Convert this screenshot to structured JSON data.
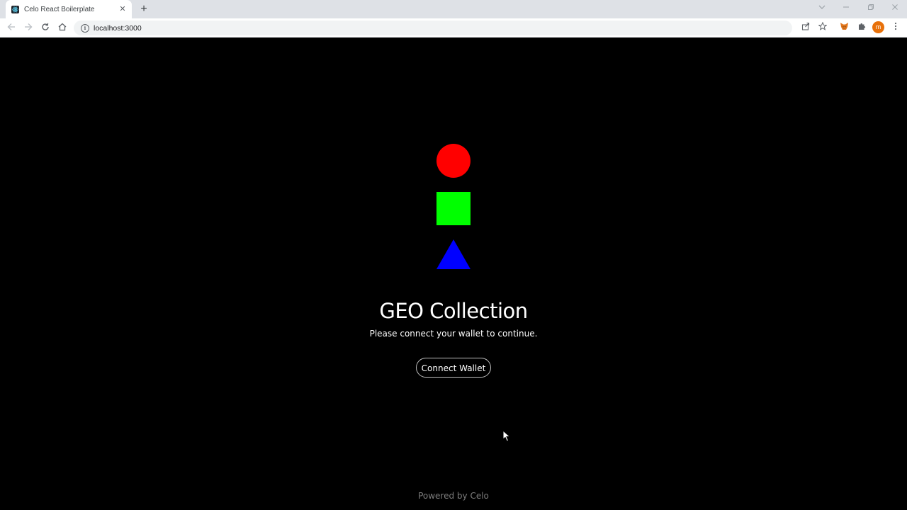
{
  "browser": {
    "tab_title": "Celo React Boilerplate",
    "tab_close": "✕",
    "new_tab": "+",
    "url": "localhost:3000",
    "icons": [
      "react-favicon-icon",
      "back-icon",
      "forward-icon",
      "reload-icon",
      "home-icon",
      "site-info-icon",
      "share-icon",
      "bookmark-star-icon",
      "metamask-icon",
      "extensions-icon",
      "profile-avatar-icon"
    ],
    "avatar_initial": "m",
    "avatar_color": "#e8710a"
  },
  "page": {
    "background": "#000000",
    "shapes": [
      {
        "name": "circle",
        "color": "#ff0000"
      },
      {
        "name": "square",
        "color": "#00ff00"
      },
      {
        "name": "triangle",
        "color": "#0000ff"
      }
    ],
    "title": "GEO Collection",
    "subtitle": "Please connect your wallet to continue.",
    "connect_button": "Connect Wallet",
    "footer": "Powered by Celo"
  }
}
